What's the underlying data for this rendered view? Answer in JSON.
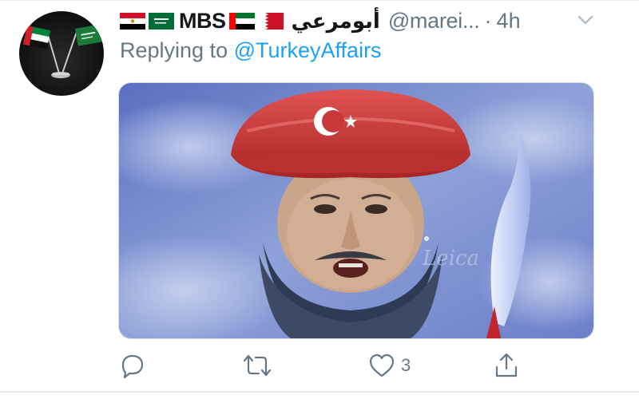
{
  "tweet": {
    "display_name": "MBS",
    "arabic_name": "أبومرعي",
    "handle": "@marei...",
    "separator": "·",
    "time": "4h",
    "reply_prefix": "Replying to",
    "reply_target": "@TurkeyAffairs",
    "image_watermark": "Leica",
    "header_flags": [
      "egypt-flag",
      "saudi-flag",
      "uae-flag",
      "bahrain-flag"
    ],
    "avatar_content": "uae and saudi desk flags",
    "actions": {
      "reply_icon": "reply-icon",
      "retweet_icon": "retweet-icon",
      "like_icon": "like-icon",
      "like_count": "3",
      "share_icon": "share-icon"
    }
  },
  "colors": {
    "primary_text": "#14171a",
    "secondary_text": "#657786",
    "link_blue": "#1da1f2",
    "divider": "#e6ecf0"
  }
}
